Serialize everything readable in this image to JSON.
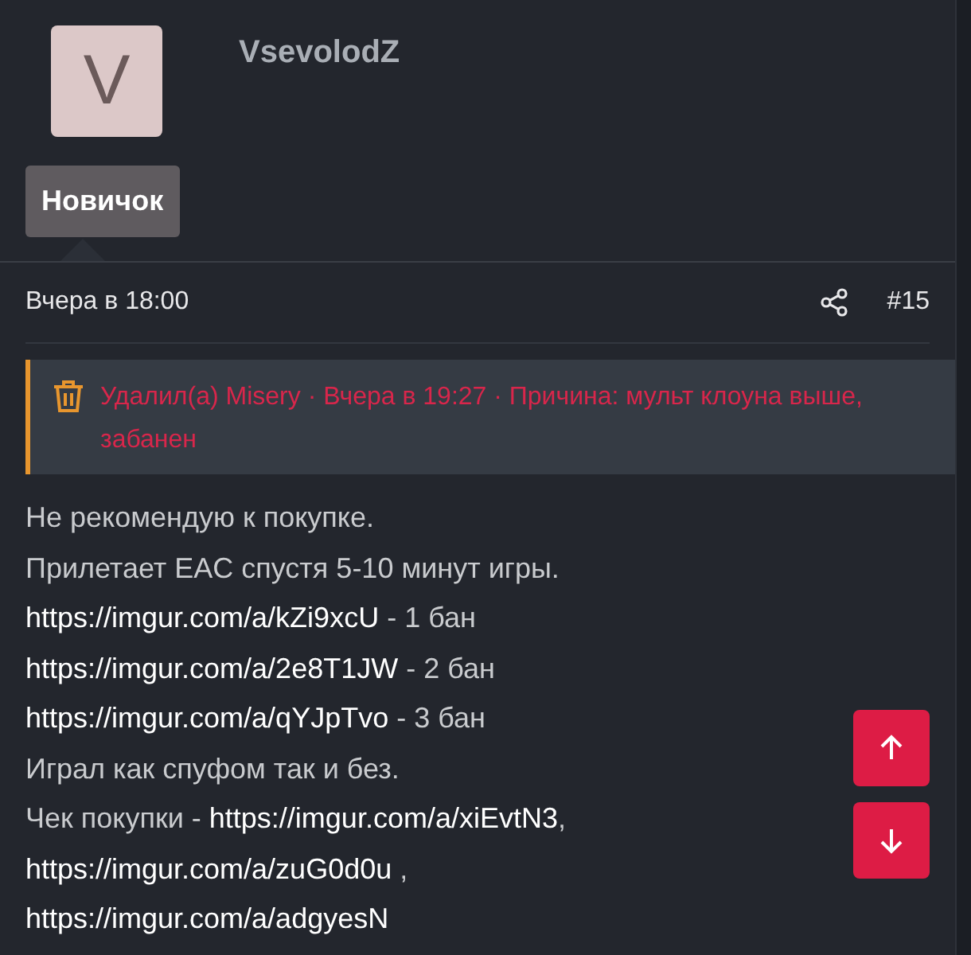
{
  "author": {
    "avatar_letter": "V",
    "name": "VsevolodZ",
    "rank": "Новичок"
  },
  "post": {
    "time": "Вчера в 18:00",
    "number": "#15"
  },
  "deleted_notice": {
    "text": "Удалил(а) Misery · Вчера в 19:27 · Причина: мульт клоуна выше, забанен"
  },
  "body": [
    [
      {
        "kind": "text",
        "text": "Не рекомендую к покупке."
      }
    ],
    [
      {
        "kind": "text",
        "text": "Прилетает EAC спустя 5-10 минут игры."
      }
    ],
    [
      {
        "kind": "link",
        "text": "https://imgur.com/a/kZi9xcU"
      },
      {
        "kind": "text",
        "text": " - 1 бан"
      }
    ],
    [
      {
        "kind": "link",
        "text": "https://imgur.com/a/2e8T1JW"
      },
      {
        "kind": "text",
        "text": " - 2 бан"
      }
    ],
    [
      {
        "kind": "link",
        "text": "https://imgur.com/a/qYJpTvo"
      },
      {
        "kind": "text",
        "text": " - 3 бан"
      }
    ],
    [
      {
        "kind": "text",
        "text": "Играл как спуфом так и без."
      }
    ],
    [
      {
        "kind": "text",
        "text": "Чек покупки - "
      },
      {
        "kind": "link",
        "text": "https://imgur.com/a/xiEvtN3"
      },
      {
        "kind": "text",
        "text": ","
      }
    ],
    [
      {
        "kind": "link",
        "text": "https://imgur.com/a/zuG0d0u"
      },
      {
        "kind": "text",
        "text": " ,"
      }
    ],
    [
      {
        "kind": "link",
        "text": "https://imgur.com/a/adgyesN"
      }
    ]
  ]
}
